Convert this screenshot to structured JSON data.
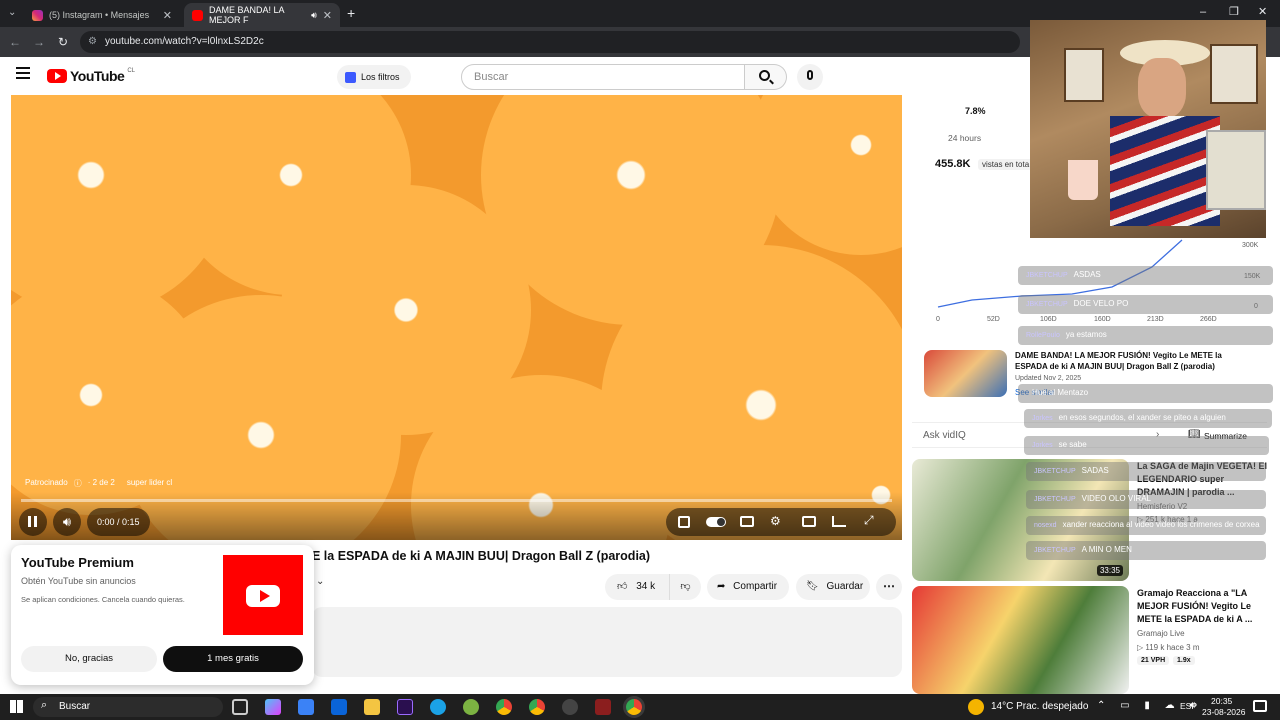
{
  "browser": {
    "tabs": [
      {
        "label": "(5) Instagram • Mensajes"
      },
      {
        "label": "DAME BANDA! LA MEJOR F"
      }
    ],
    "url": "youtube.com/watch?v=l0lnxLS2D2c"
  },
  "youtube": {
    "logo_text": "YouTube",
    "region": "CL",
    "filters_label": "Los filtros",
    "search_placeholder": "Buscar"
  },
  "video": {
    "sponsored": "Patrocinado",
    "ad_count": "· 2 de 2",
    "advertiser": "super lider cl",
    "time": "0:00 / 0:15",
    "progress": 0.0,
    "title": "E la ESPADA de ki A MAJIN BUU| Dragon Ball Z (parodia)",
    "likes": "34 k",
    "share_label": "Compartir",
    "save_label": "Guardar"
  },
  "premium_popup": {
    "title": "YouTube Premium",
    "subtitle": "Obtén YouTube sin anuncios",
    "terms": "Se aplican condiciones. Cancela cuando quieras.",
    "decline": "No, gracias",
    "accept": "1 mes gratis"
  },
  "stats": {
    "pct": "7.8%",
    "period": "24 hours",
    "views": "455.8K",
    "views_label": "vistas en tota",
    "chart_y_ticks": [
      "300K",
      "150K",
      "0"
    ],
    "chart_x_ticks": [
      "0",
      "52D",
      "106D",
      "160D",
      "213D",
      "266D"
    ]
  },
  "related_top": {
    "title": "DAME BANDA! LA MEJOR FUSIÓN! Vegito Le METE la ESPADA de ki A MAJIN BUU| Dragon Ball Z (parodia)",
    "updated": "Updated Nov 2, 2025",
    "see_similar": "See similar"
  },
  "ask": {
    "label": "Ask vidIQ",
    "summarize": "Summarize"
  },
  "recommendations": [
    {
      "title": "La SAGA de Majin VEGETA! El LEGENDARIO super DRAMAJIN | parodia ...",
      "channel": "Hemisferio V2",
      "meta": "▷ 251 k  hace 1 a",
      "duration": "33:35"
    },
    {
      "title": "Gramajo Reacciona a \"LA MEJOR FUSIÓN! Vegito Le METE la ESPADA de ki A ...",
      "channel": "Gramajo Live",
      "meta": "▷ 119 k  hace 3 m",
      "vph": "21 VPH",
      "ratio": "1.9x"
    }
  ],
  "stream_chat": [
    {
      "user": "JBKETCHUP",
      "msg": "ASDAS"
    },
    {
      "user": "JBKETCHUP",
      "msg": "DOE VELO PO"
    },
    {
      "user": "RollePoulo",
      "msg": "ya estamos"
    },
    {
      "user": "",
      "msg": "Hue al Mentazo"
    },
    {
      "user": "Jorkes",
      "msg": "en esos segundos, el xander se piteo a alguien"
    },
    {
      "user": "Jorkes",
      "msg": "se sabe"
    },
    {
      "user": "JBKETCHUP",
      "msg": "SADAS"
    },
    {
      "user": "JBKETCHUP",
      "msg": "VIDEO OLO VIRAL"
    },
    {
      "user": "nosexd",
      "msg": "xander reacciona al video video los crimenes de corxea"
    },
    {
      "user": "JBKETCHUP",
      "msg": "A MIN O MEN"
    }
  ],
  "taskbar": {
    "search": "Buscar",
    "weather": "14°C  Prac. despejado",
    "lang": "ESP",
    "time": "20:35",
    "date": "23-08-2026"
  }
}
